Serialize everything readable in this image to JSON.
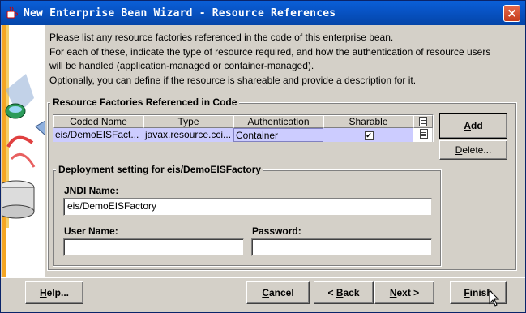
{
  "window": {
    "title": "New Enterprise Bean Wizard - Resource References",
    "close_label": "×"
  },
  "intro": {
    "line1": "Please list any resource factories referenced in the code of this enterprise bean.",
    "line2": "For each of these, indicate the type of resource required, and how the authentication of resource users",
    "line3": "will be handled (application-managed or container-managed).",
    "line4": "Optionally, you can define if the resource is shareable and provide a description for it."
  },
  "resource_group": {
    "title": "Resource Factories Referenced in Code",
    "columns": [
      "Coded Name",
      "Type",
      "Authentication",
      "Sharable"
    ],
    "rows": [
      {
        "coded_name": "eis/DemoEISFact...",
        "type": "javax.resource.cci...",
        "authentication": "Container",
        "sharable_mark": "✔"
      }
    ],
    "add_label": "Add",
    "add_mnemonic": "A",
    "add_rest": "dd",
    "delete_label": "Delete...",
    "delete_mnemonic": "D",
    "delete_rest": "elete..."
  },
  "deployment_group": {
    "title": "Deployment setting for eis/DemoEISFactory",
    "jndi_label": "JNDI Name:",
    "jndi_value": "eis/DemoEISFactory",
    "username_label": "User Name:",
    "username_value": "",
    "password_label": "Password:",
    "password_value": ""
  },
  "footer": {
    "help_label": "Help...",
    "help_mnemonic": "H",
    "help_rest": "elp...",
    "cancel_label": "Cancel",
    "cancel_mnemonic": "C",
    "cancel_rest": "ancel",
    "back_label": "< Back",
    "back_pre": "< ",
    "back_mnemonic": "B",
    "back_rest": "ack",
    "next_label": "Next >",
    "next_mnemonic": "N",
    "next_rest": "ext >",
    "finish_label": "Finish",
    "finish_mnemonic": "F",
    "finish_rest": "inish"
  },
  "colors": {
    "titlebar": "#0a5fd8",
    "selected_row": "#ccccff",
    "dialog_bg": "#d4d0c8"
  },
  "icons": {
    "app": "coffee-cup-icon",
    "close": "close-icon",
    "column_doc": "document-icon",
    "cursor": "mouse-pointer-icon"
  }
}
